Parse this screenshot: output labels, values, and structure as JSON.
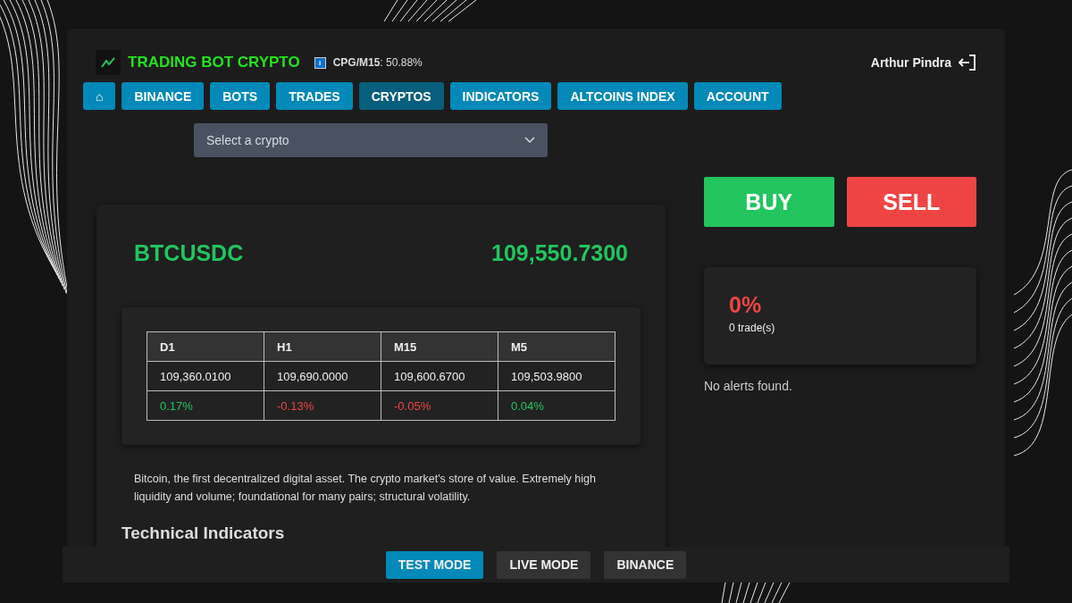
{
  "header": {
    "title": "TRADING BOT CRYPTO",
    "badge": "i",
    "metric_label": "CPG/M15",
    "metric_value": ": 50.88%",
    "user": "Arthur Pindra"
  },
  "nav": [
    {
      "label": "⌂",
      "selected": false
    },
    {
      "label": "BINANCE",
      "selected": false
    },
    {
      "label": "BOTS",
      "selected": false
    },
    {
      "label": "TRADES",
      "selected": false
    },
    {
      "label": "CRYPTOS",
      "selected": true
    },
    {
      "label": "INDICATORS",
      "selected": false
    },
    {
      "label": "ALTCOINS INDEX",
      "selected": false
    },
    {
      "label": "ACCOUNT",
      "selected": false
    }
  ],
  "crypto_select": {
    "placeholder": "Select a crypto"
  },
  "asset": {
    "symbol": "BTCUSDC",
    "price": "109,550.7300"
  },
  "timeframes": {
    "columns": [
      "D1",
      "H1",
      "M15",
      "M5"
    ],
    "prices": [
      "109,360.0100",
      "109,690.0000",
      "109,600.6700",
      "109,503.9800"
    ],
    "changes": [
      {
        "text": "0.17%",
        "color": "#22c55e"
      },
      {
        "text": "-0.13%",
        "color": "#ef4444"
      },
      {
        "text": "-0.05%",
        "color": "#ef4444"
      },
      {
        "text": "0.04%",
        "color": "#22c55e"
      }
    ]
  },
  "description": "Bitcoin, the first decentralized digital asset. The crypto market's store of value. Extremely high liquidity and volume; foundational for many pairs; structural volatility.",
  "section_heading": "Technical Indicators",
  "actions": {
    "buy": "BUY",
    "sell": "SELL"
  },
  "stats": {
    "value": "0%",
    "color": "#ef4444",
    "caption": "0 trade(s)"
  },
  "alerts": "No alerts found.",
  "modes": [
    {
      "label": "TEST MODE",
      "selected": true
    },
    {
      "label": "LIVE MODE",
      "selected": false
    },
    {
      "label": "BINANCE",
      "selected": false
    }
  ]
}
